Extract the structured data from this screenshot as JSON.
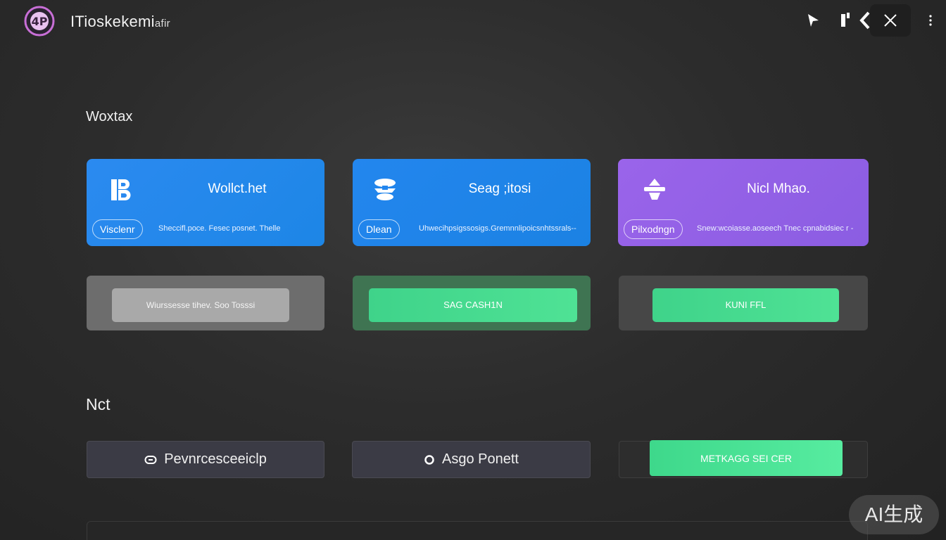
{
  "header": {
    "app_title": "ITioskekemi",
    "app_title_suffix": "afir",
    "logo_text": "4P"
  },
  "section1": {
    "title": "Woxtax"
  },
  "cards": [
    {
      "title": "Wollct.het",
      "chip": "Visclenr",
      "desc": "Sheccifl.poce. Fesec posnet. Thelle",
      "color": "#2b8af0"
    },
    {
      "title": "Seag ;itosi",
      "chip": "Dlean",
      "desc": "Uhwecihpsigssosigs.Gremnnlipoicsnhtssrals--",
      "color": "#2386ee"
    },
    {
      "title": "Nicl Mhao.",
      "chip": "Pilxodngn",
      "desc": "Snew:wcoiasse.aoseech Tnec cpnabidsiec r -",
      "color": "#9a64ea"
    }
  ],
  "panels": [
    {
      "button": "Wiurssesse     tihev. Soo Tosssi"
    },
    {
      "button": "SAG CASH1N"
    },
    {
      "button": "KUNI FFL"
    }
  ],
  "section2": {
    "title": "Nct"
  },
  "row": {
    "item1": "Pevnrcesceeiclp",
    "item2": "Asgo Ponett",
    "green_button": "METKAGG SEI CER"
  },
  "watermark": "AI生成"
}
